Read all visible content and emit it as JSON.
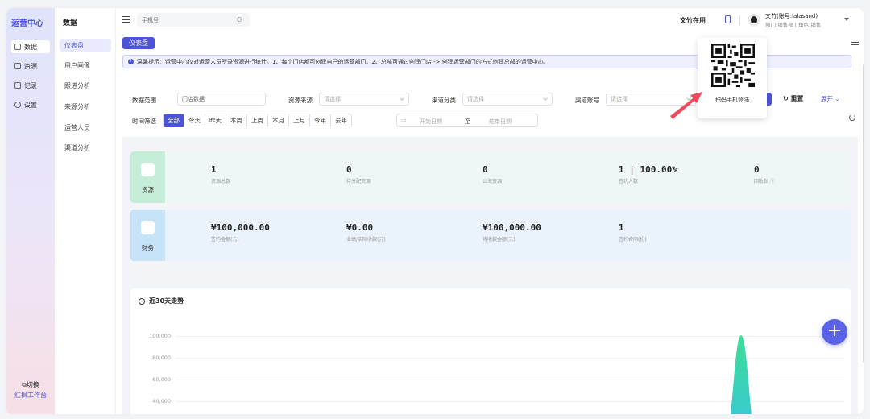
{
  "rail": {
    "title": "运营中心",
    "items": [
      {
        "label": "数据",
        "active": true
      },
      {
        "label": "资源",
        "active": false
      },
      {
        "label": "记录",
        "active": false
      },
      {
        "label": "设置",
        "active": false
      }
    ],
    "switch_label": "切换",
    "workspace_label": "红枫工作台"
  },
  "sub": {
    "title": "数据",
    "items": [
      "仪表盘",
      "用户画像",
      "跟进分析",
      "来源分析",
      "运营人员",
      "渠道分析"
    ]
  },
  "topbar": {
    "search_placeholder": "手机号",
    "status": "文竹在用",
    "user_name": "文竹(账号:lalasand)",
    "user_role": "部门:销售部 | 角色:销售"
  },
  "main": {
    "tab": "仪表盘",
    "notice": "温馨提示：运营中心仅对运营人员所录资源进行统计。1、每个门店都可创建自己的运营部门。2、总部可通过创建门店 -> 创建运营部门的方式创建总部的运营中心。"
  },
  "filters": {
    "scope_label": "数据范围",
    "scope_value": "门店数据",
    "source_label": "资源来源",
    "channel_type_label": "渠道分类",
    "channel_account_label": "渠道账号",
    "select_placeholder": "请选择",
    "reset": "重置",
    "expand": "展开",
    "time_label": "时间筛选",
    "time_buttons": [
      "全部",
      "今天",
      "昨天",
      "本周",
      "上周",
      "本月",
      "上月",
      "今年",
      "去年"
    ],
    "start_date": "开始日期",
    "to": "至",
    "end_date": "结束日期"
  },
  "resource_card": {
    "label": "资源",
    "stats": [
      {
        "value": "1",
        "label": "资源总数"
      },
      {
        "value": "0",
        "label": "待分配资源"
      },
      {
        "value": "0",
        "label": "公海资源"
      },
      {
        "value": "1 | 100.00%",
        "label": "签约人数"
      },
      {
        "value": "0",
        "label": "回收站 ⓘ"
      }
    ]
  },
  "finance_card": {
    "label": "财务",
    "stats": [
      {
        "value": "¥100,000.00",
        "label": "签约金额(元)"
      },
      {
        "value": "¥0.00",
        "label": "业绩/实际收款(元)"
      },
      {
        "value": "¥100,000.00",
        "label": "待收款金额(元)"
      },
      {
        "value": "1",
        "label": "签约合同(份)"
      }
    ]
  },
  "trend": {
    "title": "近30天走势",
    "y_ticks": [
      "100,000",
      "80,000",
      "60,000",
      "40,000"
    ]
  },
  "qr_popup": {
    "text": "扫码手机登陆"
  },
  "colors": {
    "accent": "#4b54d9",
    "arrow": "#ef4b5c",
    "peak_top": "#3ddc97",
    "peak_bottom": "#37c6e0"
  }
}
